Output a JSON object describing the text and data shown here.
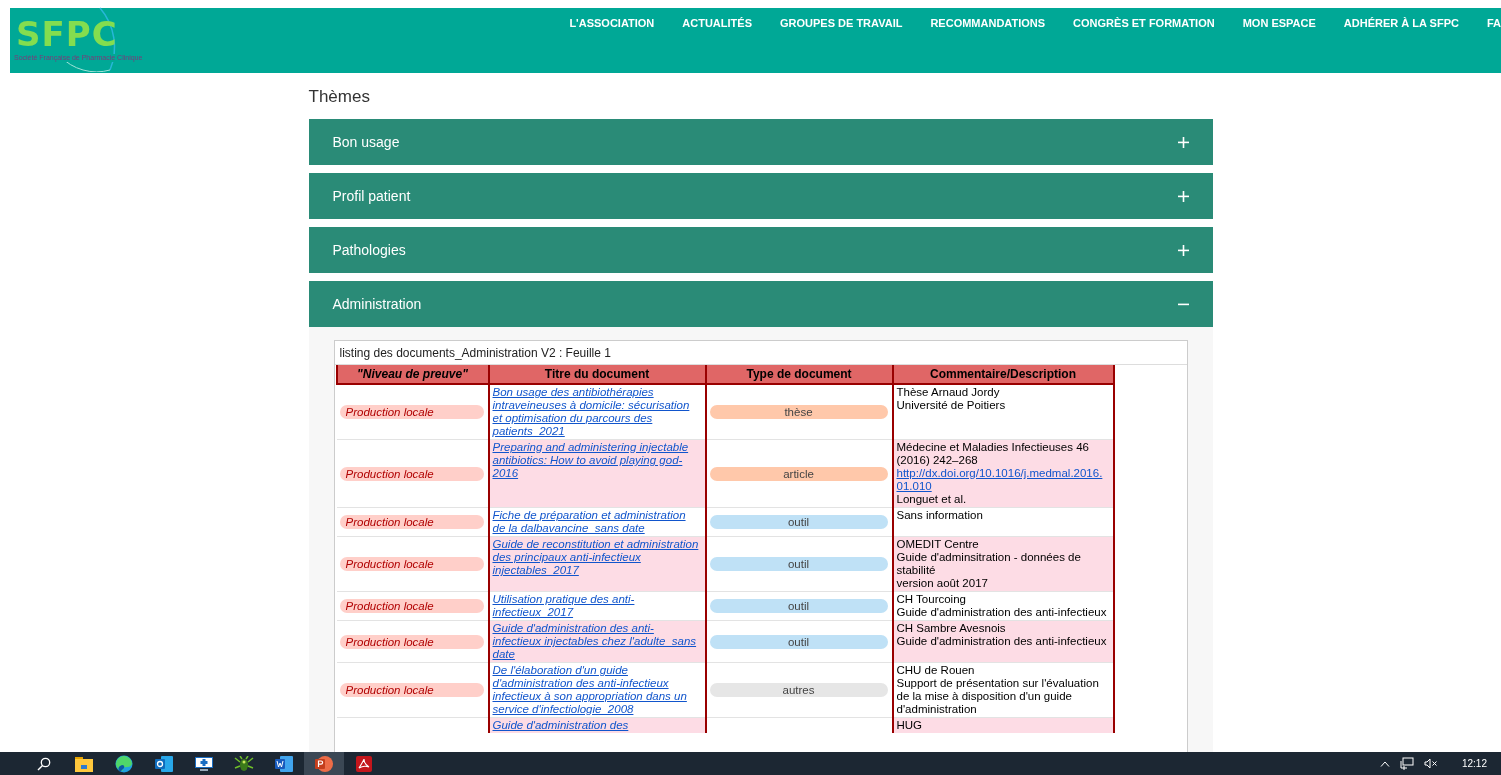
{
  "header": {
    "logo": {
      "text": "SFPC",
      "subtitle": "Société Française de Pharmacie Clinique"
    },
    "nav": [
      {
        "label": "L'ASSOCIATION"
      },
      {
        "label": "ACTUALITÉS"
      },
      {
        "label": "GROUPES DE TRAVAIL"
      },
      {
        "label": "RECOMMANDATIONS"
      },
      {
        "label": "CONGRÈS ET FORMATION"
      },
      {
        "label": "MON ESPACE"
      },
      {
        "label": "ADHÉRER À LA SFPC"
      },
      {
        "label": "FA"
      }
    ]
  },
  "section_title": "Thèmes",
  "accordion": [
    {
      "label": "Bon usage",
      "expanded": false
    },
    {
      "label": "Profil patient",
      "expanded": false
    },
    {
      "label": "Pathologies",
      "expanded": false
    },
    {
      "label": "Administration",
      "expanded": true
    }
  ],
  "sheet": {
    "title": "listing des documents_Administration V2 : Feuille 1",
    "columns": [
      "\"Niveau de preuve\"",
      "Titre du document",
      "Type de document",
      "Commentaire/Description"
    ],
    "rows": [
      {
        "evidence": {
          "label": "Production locale",
          "color": "#ffcfc9"
        },
        "title": "Bon usage des antibiothérapies intraveineuses à domicile: sécurisation et optimisation du parcours des patients_2021",
        "doc_type": {
          "label": "thèse",
          "color": "#ffc8aa"
        },
        "comment": [
          {
            "kind": "text",
            "text": "Thèse Arnaud Jordy"
          },
          {
            "kind": "text",
            "text": "Université de Poitiers"
          }
        ]
      },
      {
        "evidence": {
          "label": "Production locale",
          "color": "#ffcfc9"
        },
        "title": "Preparing and administering injectable antibiotics: How to avoid playing god-2016",
        "doc_type": {
          "label": "article",
          "color": "#ffc8aa"
        },
        "comment": [
          {
            "kind": "text",
            "text": "Médecine et Maladies Infectieuses 46 (2016) 242–268"
          },
          {
            "kind": "link",
            "text": "http://dx.doi.org/10.1016/j.medmal.2016.01.010"
          },
          {
            "kind": "text",
            "text": "Longuet et al."
          }
        ]
      },
      {
        "evidence": {
          "label": "Production locale",
          "color": "#ffcfc9"
        },
        "title": "Fiche de préparation et administration de la dalbavancine_sans date",
        "doc_type": {
          "label": "outil",
          "color": "#bfe1f6"
        },
        "comment": [
          {
            "kind": "text",
            "text": "Sans information"
          }
        ]
      },
      {
        "evidence": {
          "label": "Production locale",
          "color": "#ffcfc9"
        },
        "title": "Guide de reconstitution et administration des principaux anti-infectieux injectables_2017",
        "doc_type": {
          "label": "outil",
          "color": "#bfe1f6"
        },
        "comment": [
          {
            "kind": "text",
            "text": "OMEDIT Centre"
          },
          {
            "kind": "text",
            "text": "Guide d'adminsitration - données de stabilité"
          },
          {
            "kind": "text",
            "text": "version août 2017"
          }
        ]
      },
      {
        "evidence": {
          "label": "Production locale",
          "color": "#ffcfc9"
        },
        "title": "Utilisation pratique des anti-infectieux_2017",
        "doc_type": {
          "label": "outil",
          "color": "#bfe1f6"
        },
        "comment": [
          {
            "kind": "text",
            "text": "CH Tourcoing"
          },
          {
            "kind": "text",
            "text": "Guide d'administration des anti-infectieux"
          }
        ]
      },
      {
        "evidence": {
          "label": "Production locale",
          "color": "#ffcfc9"
        },
        "title": "Guide d'administration des anti-infectieux injectables chez l'adulte_sans date",
        "doc_type": {
          "label": "outil",
          "color": "#bfe1f6"
        },
        "comment": [
          {
            "kind": "text",
            "text": "CH Sambre Avesnois"
          },
          {
            "kind": "text",
            "text": "Guide d'administration des anti-infectieux"
          }
        ]
      },
      {
        "evidence": {
          "label": "Production locale",
          "color": "#ffcfc9"
        },
        "title": "De l'élaboration d'un guide d'administration des anti-infectieux infectieux à son appropriation dans un service d'infectiologie_2008",
        "doc_type": {
          "label": "autres",
          "color": "#e6e6e6"
        },
        "comment": [
          {
            "kind": "text",
            "text": "CHU de Rouen"
          },
          {
            "kind": "text",
            "text": "Support de présentation sur l'évaluation de la mise à disposition d'un guide d'administration"
          }
        ]
      },
      {
        "title": "Guide d'administration des",
        "comment": [
          {
            "kind": "text",
            "text": "HUG"
          }
        ]
      }
    ]
  },
  "taskbar": {
    "apps": [
      {
        "kind": "search"
      },
      {
        "kind": "folder"
      },
      {
        "kind": "browser"
      },
      {
        "kind": "mail"
      },
      {
        "kind": "medical"
      },
      {
        "kind": "insect"
      },
      {
        "kind": "document"
      },
      {
        "kind": "presentation",
        "selected": true
      },
      {
        "kind": "pdf"
      }
    ],
    "clock": "12:12"
  }
}
